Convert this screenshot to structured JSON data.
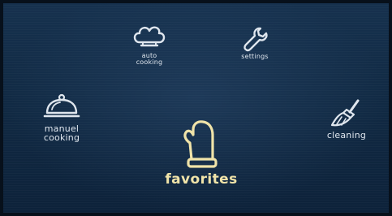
{
  "menu": {
    "auto_cooking": {
      "label": "auto\ncooking",
      "icon": "chef-hat-icon"
    },
    "settings": {
      "label": "settings",
      "icon": "wrench-icon"
    },
    "manual_cooking": {
      "label": "manuel\ncooking",
      "icon": "cloche-icon"
    },
    "cleaning": {
      "label": "cleaning",
      "icon": "brush-icon"
    },
    "favorites": {
      "label": "favorites",
      "icon": "oven-mitt-icon",
      "selected": true
    }
  },
  "colors": {
    "background": "#112a44",
    "icon": "#dfe6ee",
    "selected": "#f0e3a8"
  }
}
